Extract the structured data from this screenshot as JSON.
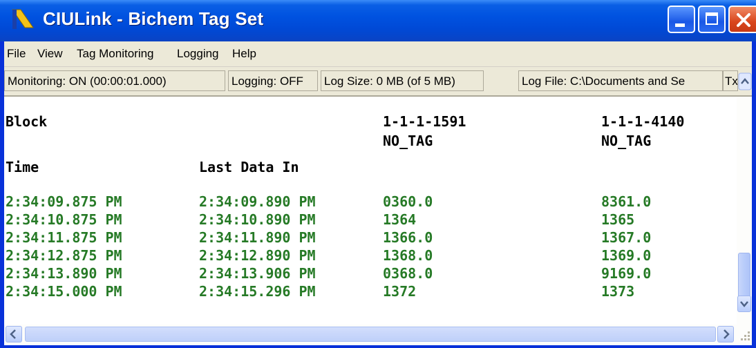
{
  "window": {
    "title": "CIULink - Bichem Tag Set",
    "titlebar_color": "#0052e0",
    "buttons": {
      "minimize_icon": "minimize-icon",
      "maximize_icon": "maximize-icon",
      "close_icon": "close-icon"
    }
  },
  "menu": {
    "items": [
      "File",
      "View",
      "Tag Monitoring",
      "Logging",
      "Help"
    ]
  },
  "status": {
    "monitoring": "Monitoring: ON (00:00:01.000)",
    "logging": "Logging: OFF",
    "log_size": "Log Size: 0 MB (of 5 MB)",
    "log_file": "Log File: C:\\Documents and Se",
    "tx": "Tx"
  },
  "table": {
    "block_label": "Block",
    "time_label": "Time",
    "last_data_label": "Last Data In",
    "columns": [
      {
        "id": "1-1-1-1591",
        "tag": "NO_TAG"
      },
      {
        "id": "1-1-1-4140",
        "tag": "NO_TAG"
      }
    ],
    "rows": [
      {
        "time": "2:34:09.875 PM",
        "last": "2:34:09.890 PM",
        "v1": "0360.0",
        "v2": "8361.0"
      },
      {
        "time": "2:34:10.875 PM",
        "last": "2:34:10.890 PM",
        "v1": "1364",
        "v2": "1365"
      },
      {
        "time": "2:34:11.875 PM",
        "last": "2:34:11.890 PM",
        "v1": "1366.0",
        "v2": "1367.0"
      },
      {
        "time": "2:34:12.875 PM",
        "last": "2:34:12.890 PM",
        "v1": "1368.0",
        "v2": "1369.0"
      },
      {
        "time": "2:34:13.890 PM",
        "last": "2:34:13.906 PM",
        "v1": "0368.0",
        "v2": "9169.0"
      },
      {
        "time": "2:34:15.000 PM",
        "last": "2:34:15.296 PM",
        "v1": "1372",
        "v2": "1373"
      }
    ],
    "data_color": "#267a26"
  }
}
